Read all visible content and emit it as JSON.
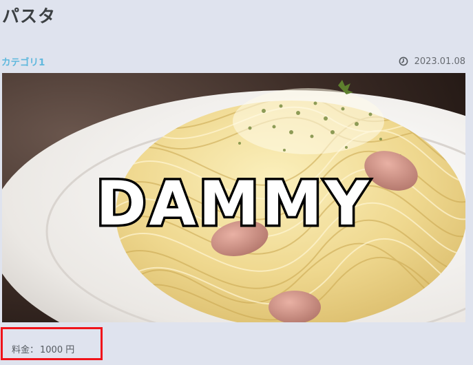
{
  "post": {
    "title": "パスタ",
    "category": "カテゴリ1",
    "date": "2023.01.08",
    "date_icon": "clock-icon",
    "image": {
      "overlay_text": "DAMMY",
      "subject": "pasta"
    },
    "price": {
      "label": "料金：",
      "value": "1000 円"
    }
  },
  "colors": {
    "background": "#dfe3ee",
    "title": "#3c4043",
    "category": "#5fb8dd",
    "meta_text": "#666a70",
    "highlight_border": "#f0131a"
  }
}
